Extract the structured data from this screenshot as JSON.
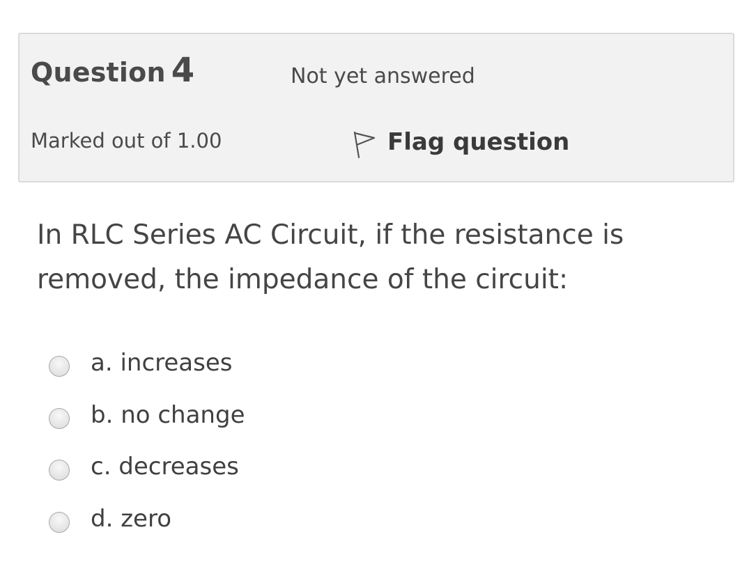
{
  "question_info": {
    "title_word": "Question",
    "number": "4",
    "state": "Not yet answered",
    "grade": "Marked out of 1.00",
    "flag_label": "Flag question",
    "flag_icon": "flag-outline-icon"
  },
  "question": {
    "text": "In RLC Series AC Circuit, if the resistance is removed, the impedance of the circuit:"
  },
  "answers": [
    {
      "label": "a. increases",
      "selected": false
    },
    {
      "label": "b. no change",
      "selected": false
    },
    {
      "label": "c. decreases",
      "selected": false
    },
    {
      "label": "d. zero",
      "selected": false
    }
  ],
  "colors": {
    "info_background": "#f2f2f2",
    "info_border": "#dadada",
    "text": "#3a3a3a"
  }
}
